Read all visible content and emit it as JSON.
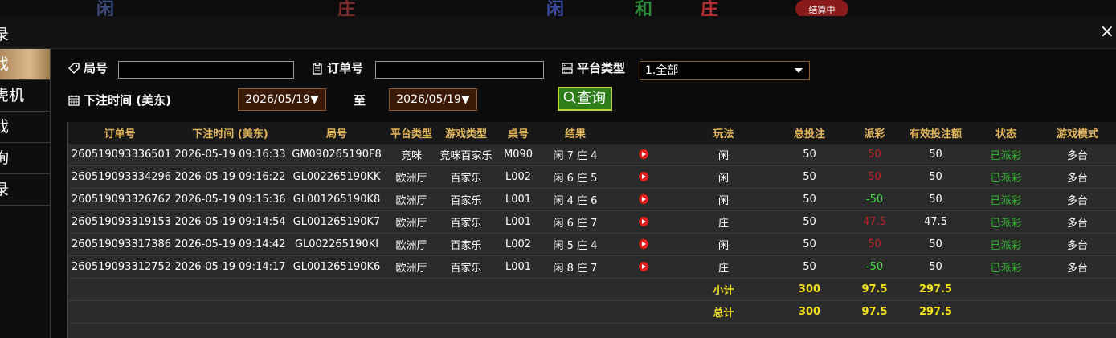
{
  "background": {
    "player_char": "闲",
    "banker_char": "庄",
    "board_player": "闲",
    "board_tie": "和",
    "board_banker": "庄",
    "status_badge": "结算中"
  },
  "window": {
    "title": "录",
    "close_glyph": "×"
  },
  "sidebar": {
    "items": [
      {
        "label": "戏"
      },
      {
        "label": "虎机"
      },
      {
        "label": "戏"
      },
      {
        "label": "询"
      },
      {
        "label": "录"
      }
    ]
  },
  "filters": {
    "round_label": "局号",
    "round_value": "",
    "order_label": "订单号",
    "order_value": "",
    "platform_label": "平台类型",
    "platform_selected": "1.全部",
    "time_label": "下注时间 (美东)",
    "date_from": "2026/05/19▼",
    "to_label": "至",
    "date_to": "2026/05/19▼",
    "query_label": "查询"
  },
  "table": {
    "headers": [
      "订单号",
      "下注时间 (美东)",
      "局号",
      "平台类型",
      "游戏类型",
      "桌号",
      "结果",
      "",
      "玩法",
      "总投注",
      "派彩",
      "有效投注额",
      "状态",
      "游戏模式"
    ],
    "rows": [
      {
        "order": "260519093336501",
        "time": "2026-05-19 09:16:33",
        "round": "GM090265190F8",
        "platform": "竞咪",
        "game": "竞咪百家乐",
        "table": "M090",
        "result": "闲 7 庄 4",
        "play": "闲",
        "bet": "50",
        "payout": "50",
        "payout_color": "red",
        "valid": "50",
        "status": "已派彩",
        "mode": "多台"
      },
      {
        "order": "260519093334296",
        "time": "2026-05-19 09:16:22",
        "round": "GL002265190KK",
        "platform": "欧洲厅",
        "game": "百家乐",
        "table": "L002",
        "result": "闲 6 庄 5",
        "play": "闲",
        "bet": "50",
        "payout": "50",
        "payout_color": "red",
        "valid": "50",
        "status": "已派彩",
        "mode": "多台"
      },
      {
        "order": "260519093326762",
        "time": "2026-05-19 09:15:36",
        "round": "GL001265190K8",
        "platform": "欧洲厅",
        "game": "百家乐",
        "table": "L001",
        "result": "闲 4 庄 6",
        "play": "闲",
        "bet": "50",
        "payout": "-50",
        "payout_color": "green",
        "valid": "50",
        "status": "已派彩",
        "mode": "多台"
      },
      {
        "order": "260519093319153",
        "time": "2026-05-19 09:14:54",
        "round": "GL001265190K7",
        "platform": "欧洲厅",
        "game": "百家乐",
        "table": "L001",
        "result": "闲 6 庄 7",
        "play": "庄",
        "bet": "50",
        "payout": "47.5",
        "payout_color": "red",
        "valid": "47.5",
        "status": "已派彩",
        "mode": "多台"
      },
      {
        "order": "260519093317386",
        "time": "2026-05-19 09:14:42",
        "round": "GL002265190KI",
        "platform": "欧洲厅",
        "game": "百家乐",
        "table": "L002",
        "result": "闲 5 庄 4",
        "play": "闲",
        "bet": "50",
        "payout": "50",
        "payout_color": "red",
        "valid": "50",
        "status": "已派彩",
        "mode": "多台"
      },
      {
        "order": "260519093312752",
        "time": "2026-05-19 09:14:17",
        "round": "GL001265190K6",
        "platform": "欧洲厅",
        "game": "百家乐",
        "table": "L001",
        "result": "闲 8 庄 7",
        "play": "庄",
        "bet": "50",
        "payout": "-50",
        "payout_color": "green",
        "valid": "50",
        "status": "已派彩",
        "mode": "多台"
      }
    ],
    "subtotal": {
      "label": "小计",
      "bet": "300",
      "payout": "97.5",
      "valid": "297.5"
    },
    "total": {
      "label": "总计",
      "bet": "300",
      "payout": "97.5",
      "valid": "297.5"
    }
  },
  "colors": {
    "header_gold": "#e4b65a",
    "payout_red": "#c41e2a",
    "payout_green": "#3fdc3f",
    "status_green": "#2fb42f",
    "total_yellow": "#f2e11b",
    "active_tab": "#c8a06a"
  }
}
